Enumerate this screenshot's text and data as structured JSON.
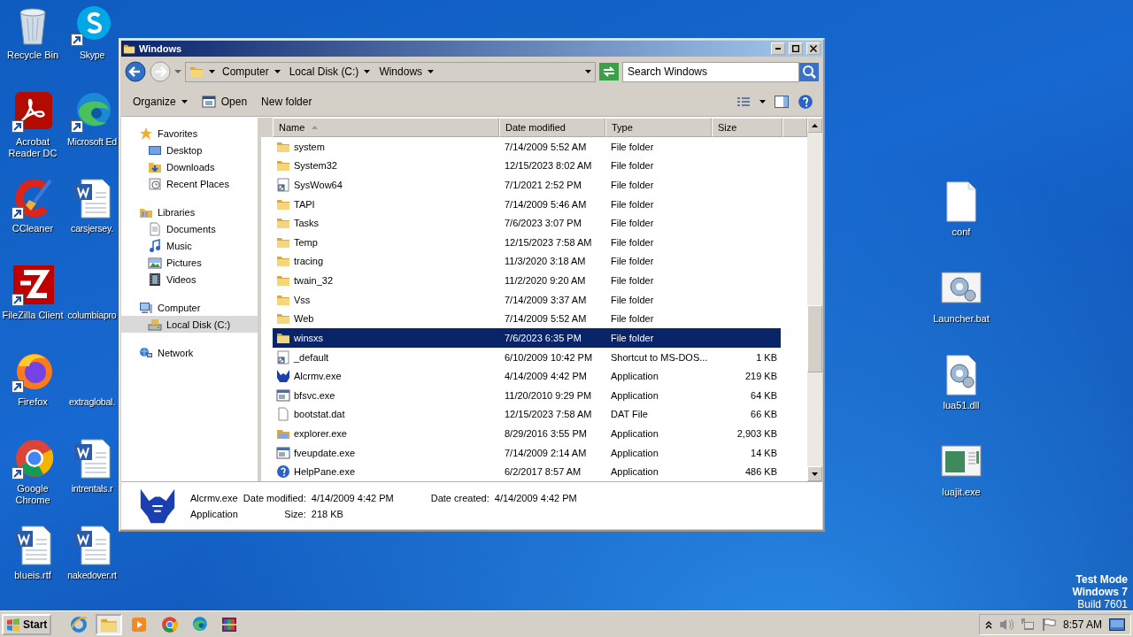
{
  "desktop": {
    "left_column_1": [
      {
        "label": "Recycle Bin",
        "kind": "recycle-bin",
        "shortcut": false
      },
      {
        "label": "Acrobat Reader DC",
        "kind": "acrobat",
        "shortcut": true
      },
      {
        "label": "CCleaner",
        "kind": "ccleaner",
        "shortcut": true
      },
      {
        "label": "FileZilla Client",
        "kind": "filezilla",
        "shortcut": true
      },
      {
        "label": "Firefox",
        "kind": "firefox",
        "shortcut": true
      },
      {
        "label": "Google Chrome",
        "kind": "chrome",
        "shortcut": true
      },
      {
        "label": "blueis.rtf",
        "kind": "word",
        "shortcut": false
      }
    ],
    "left_column_2": [
      {
        "label": "Skype",
        "kind": "skype",
        "shortcut": true
      },
      {
        "label": "Microsoft Ed",
        "kind": "edge",
        "shortcut": true
      },
      {
        "label": "carsjersey.",
        "kind": "word",
        "shortcut": false
      },
      {
        "label": "columbiapro",
        "kind": "none",
        "shortcut": false
      },
      {
        "label": "extraglobal.",
        "kind": "none",
        "shortcut": false
      },
      {
        "label": "intrentals.r",
        "kind": "word",
        "shortcut": false
      },
      {
        "label": "nakedover.rt",
        "kind": "word",
        "shortcut": false
      }
    ],
    "right_column": [
      {
        "label": "conf",
        "kind": "blank-file",
        "shortcut": false
      },
      {
        "label": "Launcher.bat",
        "kind": "gear-window",
        "shortcut": false
      },
      {
        "label": "lua51.dll",
        "kind": "gear-file",
        "shortcut": false
      },
      {
        "label": "luajit.exe",
        "kind": "app-window",
        "shortcut": false
      }
    ],
    "os_notice": [
      "Test Mode",
      "Windows 7",
      "Build 7601"
    ]
  },
  "window": {
    "title": "Windows",
    "address": {
      "crumbs": [
        "Computer",
        "Local Disk (C:)",
        "Windows"
      ]
    },
    "search": {
      "placeholder": "Search Windows"
    },
    "toolbar": [
      {
        "label": "Organize",
        "dropdown": true
      },
      {
        "label": "Open",
        "kind": "open",
        "dropdown": false
      },
      {
        "label": "New folder",
        "dropdown": false
      }
    ],
    "nav": [
      {
        "label": "Favorites",
        "kind": "star",
        "selected": false,
        "children": [
          {
            "label": "Desktop",
            "kind": "desktop",
            "selected": false
          },
          {
            "label": "Downloads",
            "kind": "downloads",
            "selected": false
          },
          {
            "label": "Recent Places",
            "kind": "recent",
            "selected": false
          }
        ]
      },
      {
        "label": "Libraries",
        "kind": "library",
        "selected": false,
        "children": [
          {
            "label": "Documents",
            "kind": "documents",
            "selected": false
          },
          {
            "label": "Music",
            "kind": "music",
            "selected": false
          },
          {
            "label": "Pictures",
            "kind": "pictures",
            "selected": false
          },
          {
            "label": "Videos",
            "kind": "videos",
            "selected": false
          }
        ]
      },
      {
        "label": "Computer",
        "kind": "computer",
        "selected": false,
        "children": [
          {
            "label": "Local Disk (C:)",
            "kind": "drive",
            "selected": true
          }
        ]
      },
      {
        "label": "Network",
        "kind": "network",
        "selected": false
      }
    ],
    "columns": [
      {
        "label": "Name",
        "sorted": true
      },
      {
        "label": "Date modified",
        "sorted": false
      },
      {
        "label": "Type",
        "sorted": false
      },
      {
        "label": "Size",
        "sorted": false
      }
    ],
    "rows": [
      {
        "name": "system",
        "date": "7/14/2009 5:52 AM",
        "type": "File folder",
        "kind": "folder",
        "selected": false
      },
      {
        "name": "System32",
        "date": "12/15/2023 8:02 AM",
        "type": "File folder",
        "kind": "folder",
        "selected": false
      },
      {
        "name": "SysWow64",
        "date": "7/1/2021 2:52 PM",
        "type": "File folder",
        "kind": "shortcut",
        "selected": false
      },
      {
        "name": "TAPI",
        "date": "7/14/2009 5:46 AM",
        "type": "File folder",
        "kind": "folder",
        "selected": false
      },
      {
        "name": "Tasks",
        "date": "7/6/2023 3:07 PM",
        "type": "File folder",
        "kind": "folder",
        "selected": false
      },
      {
        "name": "Temp",
        "date": "12/15/2023 7:58 AM",
        "type": "File folder",
        "kind": "folder",
        "selected": false
      },
      {
        "name": "tracing",
        "date": "11/3/2020 3:18 AM",
        "type": "File folder",
        "kind": "folder",
        "selected": false
      },
      {
        "name": "twain_32",
        "date": "11/2/2020 9:20 AM",
        "type": "File folder",
        "kind": "folder",
        "selected": false
      },
      {
        "name": "Vss",
        "date": "7/14/2009 3:37 AM",
        "type": "File folder",
        "kind": "folder",
        "selected": false
      },
      {
        "name": "Web",
        "date": "7/14/2009 5:52 AM",
        "type": "File folder",
        "kind": "folder",
        "selected": false
      },
      {
        "name": "winsxs",
        "date": "7/6/2023 6:35 PM",
        "type": "File folder",
        "kind": "folder",
        "selected": true
      },
      {
        "name": "_default",
        "date": "6/10/2009 10:42 PM",
        "type": "Shortcut to MS-DOS...",
        "size": "1 KB",
        "kind": "shortcut",
        "selected": false
      },
      {
        "name": "Alcrmv.exe",
        "date": "4/14/2009 4:42 PM",
        "type": "Application",
        "size": "219 KB",
        "kind": "realtek",
        "selected": false
      },
      {
        "name": "bfsvc.exe",
        "date": "11/20/2010 9:29 PM",
        "type": "Application",
        "size": "64 KB",
        "kind": "window-app",
        "selected": false
      },
      {
        "name": "bootstat.dat",
        "date": "12/15/2023 7:58 AM",
        "type": "DAT File",
        "size": "66 KB",
        "kind": "file",
        "selected": false
      },
      {
        "name": "explorer.exe",
        "date": "8/29/2016 3:55 PM",
        "type": "Application",
        "size": "2,903 KB",
        "kind": "explorer",
        "selected": false
      },
      {
        "name": "fveupdate.exe",
        "date": "7/14/2009 2:14 AM",
        "type": "Application",
        "size": "14 KB",
        "kind": "window-app",
        "selected": false
      },
      {
        "name": "HelpPane.exe",
        "date": "6/2/2017 8:57 AM",
        "type": "Application",
        "size": "486 KB",
        "kind": "help",
        "selected": false
      }
    ],
    "details": {
      "name": "Alcrmv.exe",
      "type": "Application",
      "properties": [
        {
          "label": "Date modified:",
          "value": "4/14/2009 4:42 PM"
        },
        {
          "label": "Date created:",
          "value": "4/14/2009 4:42 PM"
        },
        {
          "label": "Size:",
          "value": "218 KB"
        }
      ]
    }
  },
  "taskbar": {
    "start": "Start",
    "apps": [
      {
        "kind": "ie",
        "active": false
      },
      {
        "kind": "explorer",
        "active": true
      },
      {
        "kind": "media",
        "active": false
      },
      {
        "kind": "chrome",
        "active": false
      },
      {
        "kind": "edge",
        "active": false
      },
      {
        "kind": "winrar",
        "active": false
      }
    ],
    "clock": "8:57 AM"
  }
}
